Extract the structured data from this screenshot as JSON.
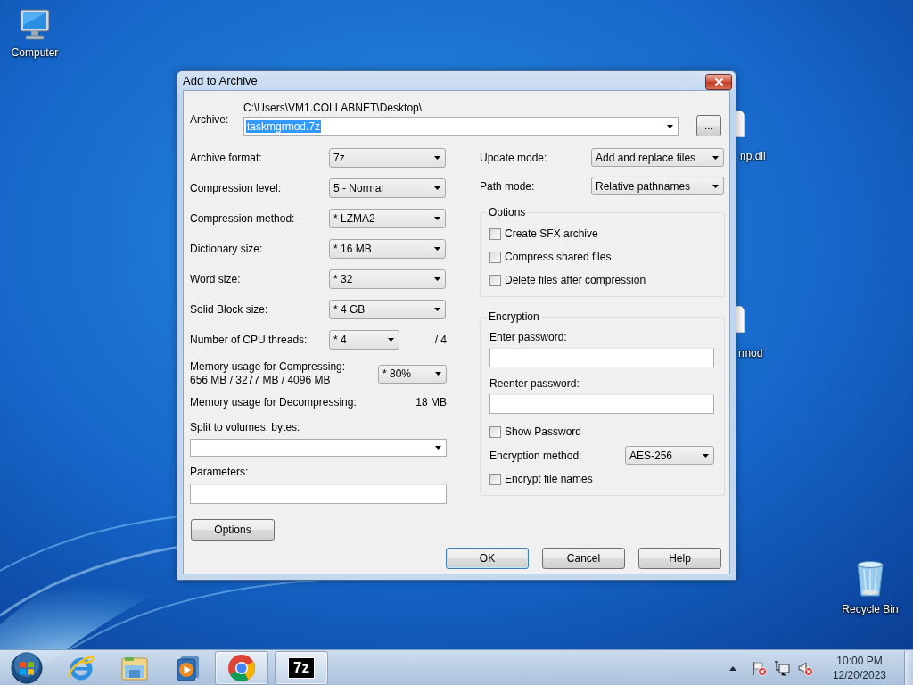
{
  "desktop_icons": [
    {
      "kind": "computer",
      "label": "Computer"
    },
    {
      "kind": "file",
      "label": "np.dll"
    },
    {
      "kind": "file",
      "label": "rmod"
    },
    {
      "kind": "recycle_bin",
      "label": "Recycle Bin"
    }
  ],
  "dialog": {
    "title": "Add to Archive",
    "archive": {
      "label": "Archive:",
      "folder": "C:\\Users\\VM1.COLLABNET\\Desktop\\",
      "value": "taskmgrmod.7z",
      "highlighted": true,
      "browse_button": "..."
    },
    "settings_left": [
      {
        "label": "Archive format:",
        "value": "7z"
      },
      {
        "label": "Compression level:",
        "value": "5 - Normal"
      },
      {
        "label": "Compression method:",
        "value": "* LZMA2"
      },
      {
        "label": "Dictionary size:",
        "value": "* 16 MB"
      },
      {
        "label": "Word size:",
        "value": "* 32"
      },
      {
        "label": "Solid Block size:",
        "value": "* 4 GB"
      },
      {
        "label": "Number of CPU threads:",
        "value": "* 4",
        "limit": "/ 4"
      }
    ],
    "memory_compressing": {
      "label": "Memory usage for Compressing:",
      "detail": "656 MB / 3277 MB / 4096 MB",
      "value": "* 80%"
    },
    "memory_decompressing": {
      "label": "Memory usage for Decompressing:",
      "value": "18 MB"
    },
    "split": {
      "label": "Split to volumes, bytes:"
    },
    "parameters": {
      "label": "Parameters:"
    },
    "options_button": "Options",
    "settings_right": [
      {
        "label": "Update mode:",
        "value": "Add and replace files"
      },
      {
        "label": "Path mode:",
        "value": "Relative pathnames"
      }
    ],
    "options_group": {
      "title": "Options",
      "checkboxes": [
        {
          "label": "Create SFX archive",
          "checked": false
        },
        {
          "label": "Compress shared files",
          "checked": false
        },
        {
          "label": "Delete files after compression",
          "checked": false
        }
      ]
    },
    "encryption": {
      "title": "Encryption",
      "password_label": "Enter password:",
      "reenter_label": "Reenter password:",
      "show_password": {
        "label": "Show Password",
        "checked": false
      },
      "method": {
        "label": "Encryption method:",
        "value": "AES-256"
      },
      "encrypt_names": {
        "label": "Encrypt file names",
        "checked": false
      }
    },
    "buttons": [
      {
        "label": "OK",
        "focused": true
      },
      {
        "label": "Cancel",
        "focused": false
      },
      {
        "label": "Help",
        "focused": false
      }
    ]
  },
  "taskbar": {
    "apps": [
      {
        "kind": "start",
        "running": false
      },
      {
        "kind": "ie",
        "running": false
      },
      {
        "kind": "explorer",
        "running": false
      },
      {
        "kind": "media_player",
        "running": false
      },
      {
        "kind": "chrome",
        "running": true
      },
      {
        "kind": "archiver",
        "running": true,
        "label": "7z"
      }
    ],
    "tray_icons": [
      {
        "kind": "arrow",
        "error": false
      },
      {
        "kind": "flag",
        "error": true
      },
      {
        "kind": "network",
        "error": false
      },
      {
        "kind": "speaker",
        "error": true
      }
    ],
    "clock": {
      "time": "10:00 PM",
      "date": "12/20/2023"
    }
  }
}
